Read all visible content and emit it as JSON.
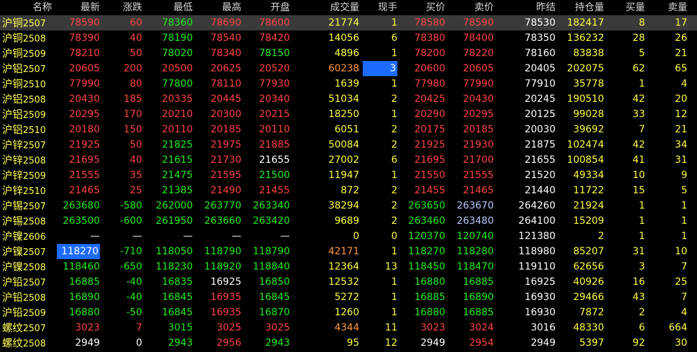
{
  "columns": [
    "名称",
    "最新",
    "涨跌",
    "最低",
    "最高",
    "开盘",
    "成交量",
    "现手",
    "买价",
    "卖价",
    "昨结",
    "持仓量",
    "买量",
    "卖量"
  ],
  "rows": [
    {
      "name": "沪铜",
      "code": "2507",
      "last": "78590",
      "change": "60",
      "low": "78360",
      "high": "78690",
      "open": "78600",
      "volume": "21774",
      "hand": "1",
      "bid": "78580",
      "ask": "78590",
      "settle": "78530",
      "oi": "182417",
      "bidvol": "8",
      "askvol": "17"
    },
    {
      "name": "沪铜",
      "code": "2508",
      "last": "78390",
      "change": "40",
      "low": "78190",
      "high": "78540",
      "open": "78420",
      "volume": "14056",
      "hand": "6",
      "bid": "78380",
      "ask": "78400",
      "settle": "78350",
      "oi": "136232",
      "bidvol": "28",
      "askvol": "26"
    },
    {
      "name": "沪铜",
      "code": "2509",
      "last": "78210",
      "change": "50",
      "low": "78020",
      "high": "78340",
      "open": "78150",
      "volume": "4896",
      "hand": "1",
      "bid": "78200",
      "ask": "78220",
      "settle": "78160",
      "oi": "83838",
      "bidvol": "5",
      "askvol": "21"
    },
    {
      "name": "沪铝",
      "code": "2507",
      "last": "20605",
      "change": "200",
      "low": "20500",
      "high": "20625",
      "open": "20520",
      "volume": "60238",
      "hand": "3",
      "bid": "20600",
      "ask": "20605",
      "settle": "20405",
      "oi": "202075",
      "bidvol": "62",
      "askvol": "65"
    },
    {
      "name": "沪铜",
      "code": "2510",
      "last": "77990",
      "change": "80",
      "low": "77800",
      "high": "78110",
      "open": "77930",
      "volume": "1639",
      "hand": "1",
      "bid": "77980",
      "ask": "77990",
      "settle": "77910",
      "oi": "35778",
      "bidvol": "1",
      "askvol": "4"
    },
    {
      "name": "沪铝",
      "code": "2508",
      "last": "20430",
      "change": "185",
      "low": "20335",
      "high": "20445",
      "open": "20340",
      "volume": "51034",
      "hand": "2",
      "bid": "20425",
      "ask": "20430",
      "settle": "20245",
      "oi": "190510",
      "bidvol": "42",
      "askvol": "20"
    },
    {
      "name": "沪铝",
      "code": "2509",
      "last": "20295",
      "change": "170",
      "low": "20210",
      "high": "20300",
      "open": "20215",
      "volume": "18250",
      "hand": "1",
      "bid": "20290",
      "ask": "20295",
      "settle": "20125",
      "oi": "99028",
      "bidvol": "33",
      "askvol": "12"
    },
    {
      "name": "沪铝",
      "code": "2510",
      "last": "20180",
      "change": "150",
      "low": "20110",
      "high": "20185",
      "open": "20110",
      "volume": "6051",
      "hand": "2",
      "bid": "20175",
      "ask": "20185",
      "settle": "20030",
      "oi": "39692",
      "bidvol": "7",
      "askvol": "21"
    },
    {
      "name": "沪锌",
      "code": "2507",
      "last": "21925",
      "change": "50",
      "low": "21825",
      "high": "21975",
      "open": "21885",
      "volume": "50084",
      "hand": "2",
      "bid": "21925",
      "ask": "21930",
      "settle": "21875",
      "oi": "102474",
      "bidvol": "42",
      "askvol": "34"
    },
    {
      "name": "沪锌",
      "code": "2508",
      "last": "21695",
      "change": "40",
      "low": "21615",
      "high": "21730",
      "open": "21655",
      "volume": "27002",
      "hand": "6",
      "bid": "21695",
      "ask": "21700",
      "settle": "21655",
      "oi": "100854",
      "bidvol": "41",
      "askvol": "31"
    },
    {
      "name": "沪锌",
      "code": "2509",
      "last": "21555",
      "change": "35",
      "low": "21475",
      "high": "21595",
      "open": "21500",
      "volume": "11947",
      "hand": "1",
      "bid": "21550",
      "ask": "21555",
      "settle": "21520",
      "oi": "49334",
      "bidvol": "10",
      "askvol": "9"
    },
    {
      "name": "沪锌",
      "code": "2510",
      "last": "21465",
      "change": "25",
      "low": "21385",
      "high": "21490",
      "open": "21455",
      "volume": "872",
      "hand": "2",
      "bid": "21455",
      "ask": "21465",
      "settle": "21440",
      "oi": "11722",
      "bidvol": "15",
      "askvol": "5"
    },
    {
      "name": "沪锡",
      "code": "2507",
      "last": "263680",
      "change": "-580",
      "low": "262000",
      "high": "263770",
      "open": "263340",
      "volume": "38294",
      "hand": "2",
      "bid": "263650",
      "ask": "263670",
      "settle": "264260",
      "oi": "21924",
      "bidvol": "1",
      "askvol": "1"
    },
    {
      "name": "沪锡",
      "code": "2508",
      "last": "263500",
      "change": "-600",
      "low": "261950",
      "high": "263660",
      "open": "263420",
      "volume": "9689",
      "hand": "2",
      "bid": "263460",
      "ask": "263480",
      "settle": "264100",
      "oi": "15209",
      "bidvol": "1",
      "askvol": "1"
    },
    {
      "name": "沪镍",
      "code": "2606",
      "last": "—",
      "change": "—",
      "low": "—",
      "high": "—",
      "open": "—",
      "volume": "0",
      "hand": "0",
      "bid": "120370",
      "ask": "120740",
      "settle": "121380",
      "oi": "2",
      "bidvol": "1",
      "askvol": "1"
    },
    {
      "name": "沪镍",
      "code": "2507",
      "last": "118270",
      "change": "-710",
      "low": "118050",
      "high": "118790",
      "open": "118790",
      "volume": "42171",
      "hand": "1",
      "bid": "118270",
      "ask": "118280",
      "settle": "118980",
      "oi": "85207",
      "bidvol": "31",
      "askvol": "10"
    },
    {
      "name": "沪镍",
      "code": "2508",
      "last": "118460",
      "change": "-650",
      "low": "118230",
      "high": "118920",
      "open": "118840",
      "volume": "12364",
      "hand": "13",
      "bid": "118450",
      "ask": "118470",
      "settle": "119110",
      "oi": "62656",
      "bidvol": "3",
      "askvol": "7"
    },
    {
      "name": "沪铅",
      "code": "2507",
      "last": "16885",
      "change": "-40",
      "low": "16835",
      "high": "16925",
      "open": "16850",
      "volume": "12532",
      "hand": "1",
      "bid": "16880",
      "ask": "16885",
      "settle": "16925",
      "oi": "40926",
      "bidvol": "16",
      "askvol": "25"
    },
    {
      "name": "沪铅",
      "code": "2508",
      "last": "16890",
      "change": "-40",
      "low": "16845",
      "high": "16935",
      "open": "16845",
      "volume": "5272",
      "hand": "1",
      "bid": "16885",
      "ask": "16890",
      "settle": "16930",
      "oi": "29466",
      "bidvol": "43",
      "askvol": "7"
    },
    {
      "name": "沪铅",
      "code": "2509",
      "last": "16880",
      "change": "-50",
      "low": "16845",
      "high": "16935",
      "open": "16870",
      "volume": "1260",
      "hand": "1",
      "bid": "16880",
      "ask": "16885",
      "settle": "16930",
      "oi": "7872",
      "bidvol": "2",
      "askvol": "4"
    },
    {
      "name": "螺纹",
      "code": "2507",
      "last": "3023",
      "change": "7",
      "low": "3015",
      "high": "3025",
      "open": "3025",
      "volume": "4344",
      "hand": "11",
      "bid": "3023",
      "ask": "3024",
      "settle": "3016",
      "oi": "48330",
      "bidvol": "6",
      "askvol": "664"
    },
    {
      "name": "螺纹",
      "code": "2508",
      "last": "2949",
      "change": "0",
      "low": "2943",
      "high": "2956",
      "open": "2943",
      "volume": "95",
      "hand": "12",
      "bid": "2949",
      "ask": "2954",
      "settle": "2949",
      "oi": "5397",
      "bidvol": "92",
      "askvol": "30"
    }
  ]
}
